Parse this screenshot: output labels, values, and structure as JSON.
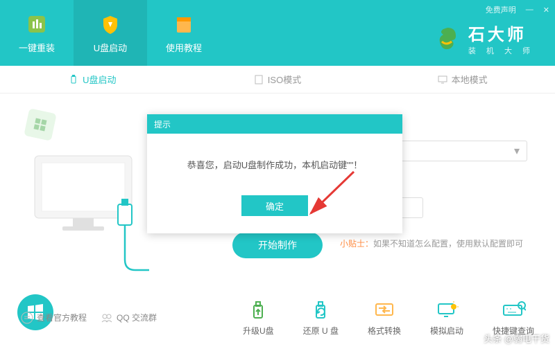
{
  "window": {
    "disclaimer": "免费声明",
    "minimize": "—",
    "close": "✕"
  },
  "brand": {
    "name": "石大师",
    "sub": "装 机 大 师"
  },
  "nav": [
    {
      "label": "一键重装"
    },
    {
      "label": "U盘启动"
    },
    {
      "label": "使用教程"
    }
  ],
  "subtabs": [
    {
      "label": "U盘启动"
    },
    {
      "label": "ISO模式"
    },
    {
      "label": "本地模式"
    }
  ],
  "dropdown_arrow": "▾",
  "start_button": "开始制作",
  "tip": {
    "prefix": "小贴士：",
    "text": "如果不知道怎么配置，使用默认配置即可"
  },
  "modal": {
    "title": "提示",
    "message": "恭喜您，启动U盘制作成功，本机启动键\"\"！",
    "ok": "确定"
  },
  "tools_left": [
    {
      "label": "查看官方教程"
    },
    {
      "label": "QQ 交流群"
    }
  ],
  "tools_right": [
    {
      "label": "升级U盘"
    },
    {
      "label": "还原 U 盘"
    },
    {
      "label": "格式转换"
    },
    {
      "label": "模拟启动"
    },
    {
      "label": "快捷键查询"
    }
  ],
  "watermark": "头条 @弱电干货"
}
